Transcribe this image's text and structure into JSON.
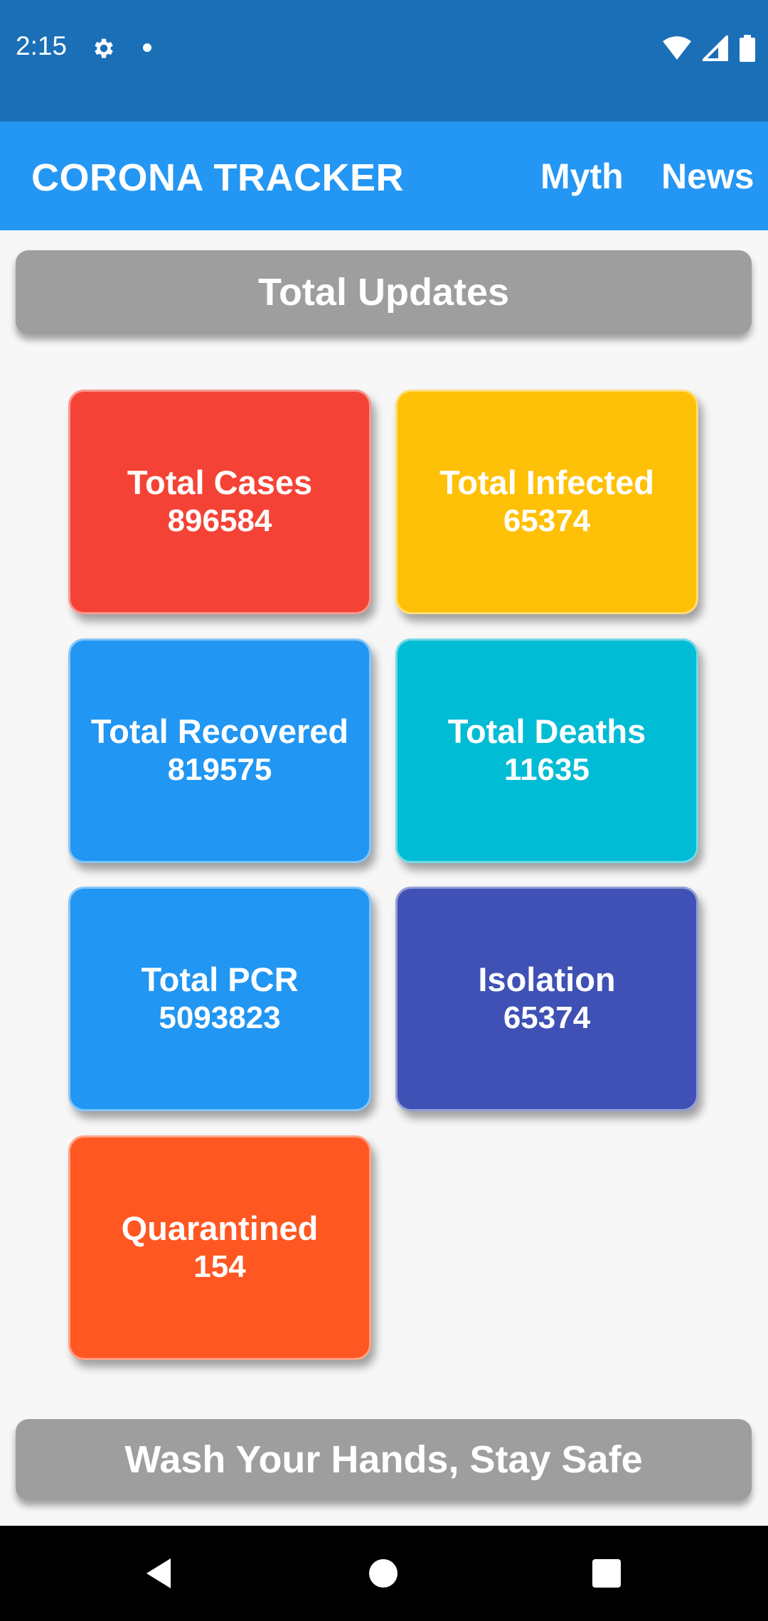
{
  "status_bar": {
    "time": "2:15",
    "icons": [
      "gear-icon",
      "notification-dot-icon",
      "wifi-icon",
      "signal-icon",
      "battery-icon"
    ],
    "color": "#1b6fb7"
  },
  "app_bar": {
    "title": "CORONA TRACKER",
    "actions": {
      "myth": "Myth",
      "news": "News"
    },
    "color": "#2496f3"
  },
  "header_banner": {
    "text": "Total Updates"
  },
  "cards": [
    {
      "label": "Total Cases",
      "value": "896584",
      "color": "#f44336"
    },
    {
      "label": "Total Infected",
      "value": "65374",
      "color": "#ffc107"
    },
    {
      "label": "Total Recovered",
      "value": "819575",
      "color": "#2196f3"
    },
    {
      "label": "Total Deaths",
      "value": "11635",
      "color": "#00bcd4"
    },
    {
      "label": "Total PCR",
      "value": "5093823",
      "color": "#2196f3"
    },
    {
      "label": "Isolation",
      "value": "65374",
      "color": "#3f51b5"
    },
    {
      "label": "Quarantined",
      "value": "154",
      "color": "#ff5722"
    }
  ],
  "footer_banner": {
    "text": "Wash Your Hands, Stay Safe"
  },
  "nav_bar": {
    "icons": [
      "back-icon",
      "home-icon",
      "recents-icon"
    ]
  }
}
